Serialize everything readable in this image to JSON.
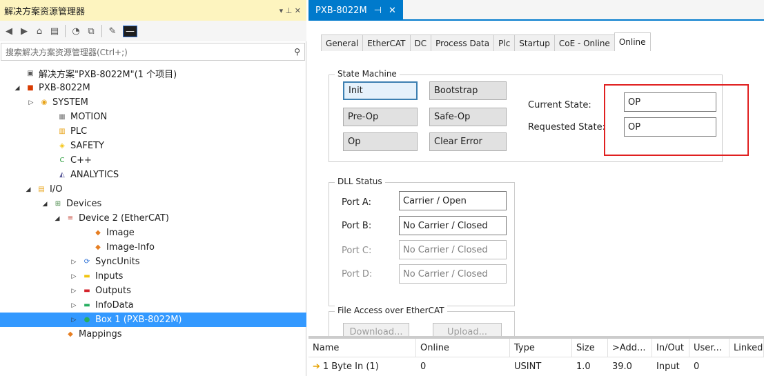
{
  "left_panel": {
    "title": "解决方案资源管理器",
    "title_controls": "▾ ⊥ ✕",
    "search_placeholder": "搜索解决方案资源管理器(Ctrl+;)",
    "tree": [
      {
        "label": "解决方案\"PXB-8022M\"(1 个项目)",
        "arrow": "",
        "icon": "solution-icon",
        "icon_color": "#5a5a5a"
      },
      {
        "label": "PXB-8022M",
        "arrow": "◢",
        "icon": "project-icon",
        "icon_color": "#d83b01"
      },
      {
        "label": "SYSTEM",
        "arrow": "▷",
        "icon": "system-icon",
        "icon_color": "#e8a317"
      },
      {
        "label": "MOTION",
        "arrow": "",
        "icon": "motion-icon",
        "icon_color": "#7a7a7a"
      },
      {
        "label": "PLC",
        "arrow": "",
        "icon": "plc-icon",
        "icon_color": "#e8a317"
      },
      {
        "label": "SAFETY",
        "arrow": "",
        "icon": "safety-icon",
        "icon_color": "#f5c518"
      },
      {
        "label": "C++",
        "arrow": "",
        "icon": "cpp-icon",
        "icon_color": "#2e9e3e"
      },
      {
        "label": "ANALYTICS",
        "arrow": "",
        "icon": "analytics-icon",
        "icon_color": "#5b5b9a"
      },
      {
        "label": "I/O",
        "arrow": "◢",
        "icon": "io-icon",
        "icon_color": "#e8a317"
      },
      {
        "label": "Devices",
        "arrow": "◢",
        "icon": "devices-icon",
        "icon_color": "#4a8a4a"
      },
      {
        "label": "Device 2 (EtherCAT)",
        "arrow": "◢",
        "icon": "ethercat-device-icon",
        "icon_color": "#c0392b"
      },
      {
        "label": "Image",
        "arrow": "",
        "icon": "image-icon",
        "icon_color": "#e67e22"
      },
      {
        "label": "Image-Info",
        "arrow": "",
        "icon": "image-info-icon",
        "icon_color": "#e67e22"
      },
      {
        "label": "SyncUnits",
        "arrow": "▷",
        "icon": "syncunits-icon",
        "icon_color": "#2a6fd6"
      },
      {
        "label": "Inputs",
        "arrow": "▷",
        "icon": "inputs-icon",
        "icon_color": "#f1c40f"
      },
      {
        "label": "Outputs",
        "arrow": "▷",
        "icon": "outputs-icon",
        "icon_color": "#d4222a"
      },
      {
        "label": "InfoData",
        "arrow": "▷",
        "icon": "infodata-icon",
        "icon_color": "#27ae60"
      },
      {
        "label": "Box 1 (PXB-8022M)",
        "arrow": "▷",
        "icon": "box-icon",
        "icon_color": "#27ae60"
      },
      {
        "label": "Mappings",
        "arrow": "",
        "icon": "mappings-icon",
        "icon_color": "#e67e22"
      }
    ]
  },
  "document_tab": {
    "title": "PXB-8022M",
    "pin": "⊣",
    "close": "✕"
  },
  "property_tabs": [
    "General",
    "EtherCAT",
    "DC",
    "Process Data",
    "Plc",
    "Startup",
    "CoE - Online",
    "Online"
  ],
  "state_machine": {
    "title": "State Machine",
    "buttons": [
      "Init",
      "Bootstrap",
      "Pre-Op",
      "Safe-Op",
      "Op",
      "Clear Error"
    ],
    "current_state_label": "Current State:",
    "current_state_value": "OP",
    "requested_state_label": "Requested State:",
    "requested_state_value": "OP"
  },
  "dll_status": {
    "title": "DLL Status",
    "ports": [
      {
        "label": "Port A:",
        "value": "Carrier / Open"
      },
      {
        "label": "Port B:",
        "value": "No Carrier / Closed"
      },
      {
        "label": "Port C:",
        "value": "No Carrier / Closed"
      },
      {
        "label": "Port D:",
        "value": "No Carrier / Closed"
      }
    ]
  },
  "file_access": {
    "title": "File Access over EtherCAT",
    "download_label": "Download...",
    "upload_label": "Upload..."
  },
  "grid": {
    "headers": [
      "Name",
      "Online",
      "Type",
      "Size",
      ">Add...",
      "In/Out",
      "User...",
      "Linked"
    ],
    "rows": [
      [
        "1 Byte In (1)",
        "0",
        "USINT",
        "1.0",
        "39.0",
        "Input",
        "0",
        ""
      ]
    ]
  },
  "colors": {
    "selection": "#3399ff",
    "accent": "#007acc",
    "highlight_box": "#e02020",
    "title_bar": "#fdf4bf"
  }
}
